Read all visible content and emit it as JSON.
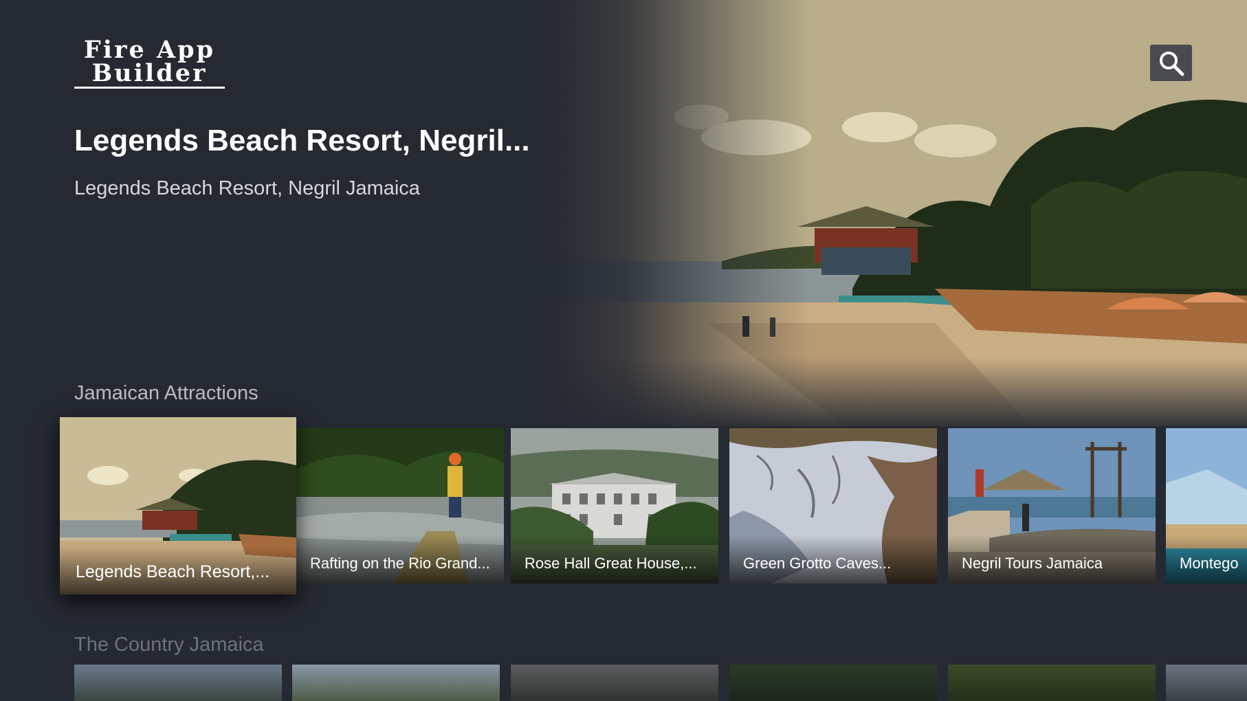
{
  "app": {
    "logo_line1": "Fire App",
    "logo_line2": "Builder"
  },
  "search": {
    "icon": "search-icon"
  },
  "hero": {
    "title": "Legends Beach Resort, Negril...",
    "subtitle": "Legends Beach Resort, Negril Jamaica"
  },
  "rows": [
    {
      "title": "Jamaican Attractions",
      "items": [
        {
          "label": "Legends Beach Resort,..."
        },
        {
          "label": "Rafting on the Rio Grand..."
        },
        {
          "label": "Rose Hall Great House,..."
        },
        {
          "label": "Green Grotto Caves..."
        },
        {
          "label": "Negril Tours Jamaica"
        },
        {
          "label": "Montego"
        }
      ]
    },
    {
      "title": "The Country Jamaica"
    }
  ],
  "colors": {
    "background": "#252932",
    "search_button": "#4a4b50"
  }
}
